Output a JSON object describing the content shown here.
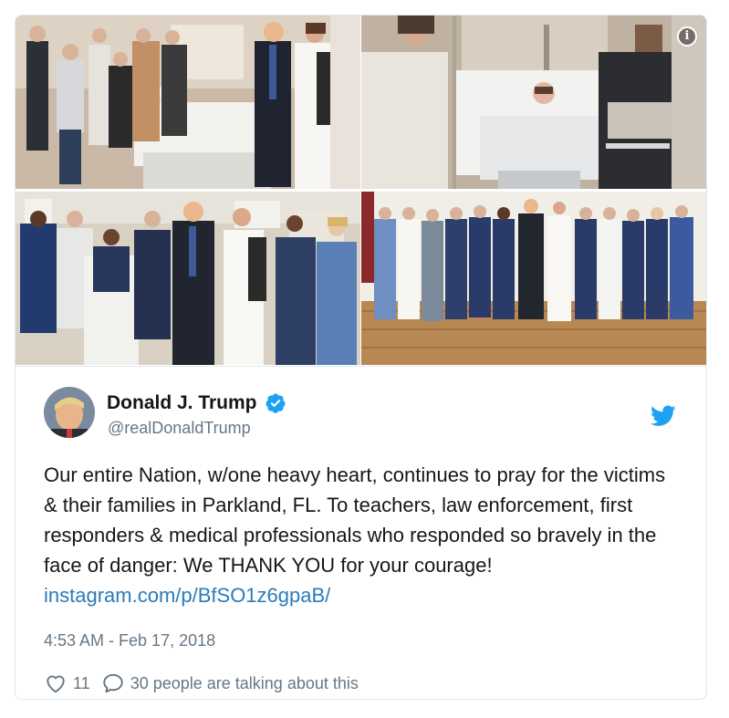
{
  "media": {
    "photos": [
      {
        "name": "photo-hospital-room-family"
      },
      {
        "name": "photo-hospital-room-patient"
      },
      {
        "name": "photo-medical-staff-group"
      },
      {
        "name": "photo-nurses-group-line"
      }
    ],
    "info_icon_glyph": "i"
  },
  "tweet": {
    "display_name": "Donald J. Trump",
    "handle": "@realDonaldTrump",
    "text": "Our entire Nation, w/one heavy heart, continues to pray for the victims & their families in Parkland, FL. To teachers, law enforcement, first responders & medical professionals who responded so bravely in the face of danger: We THANK YOU for your courage! ",
    "link": "instagram.com/p/BfSO1z6gpaB/",
    "timestamp": "4:53 AM - Feb 17, 2018",
    "like_count": "11",
    "talking_label": "30 people are talking about this"
  },
  "icons": {
    "verified": "verified-badge-icon",
    "bird": "twitter-bird-icon",
    "heart": "heart-icon",
    "reply": "speech-bubble-icon",
    "info": "info-icon"
  },
  "colors": {
    "twitter_blue": "#1da1f2",
    "link_blue": "#2b7bb9",
    "text": "#14171a",
    "secondary": "#657786",
    "border": "#e1e8ed"
  }
}
